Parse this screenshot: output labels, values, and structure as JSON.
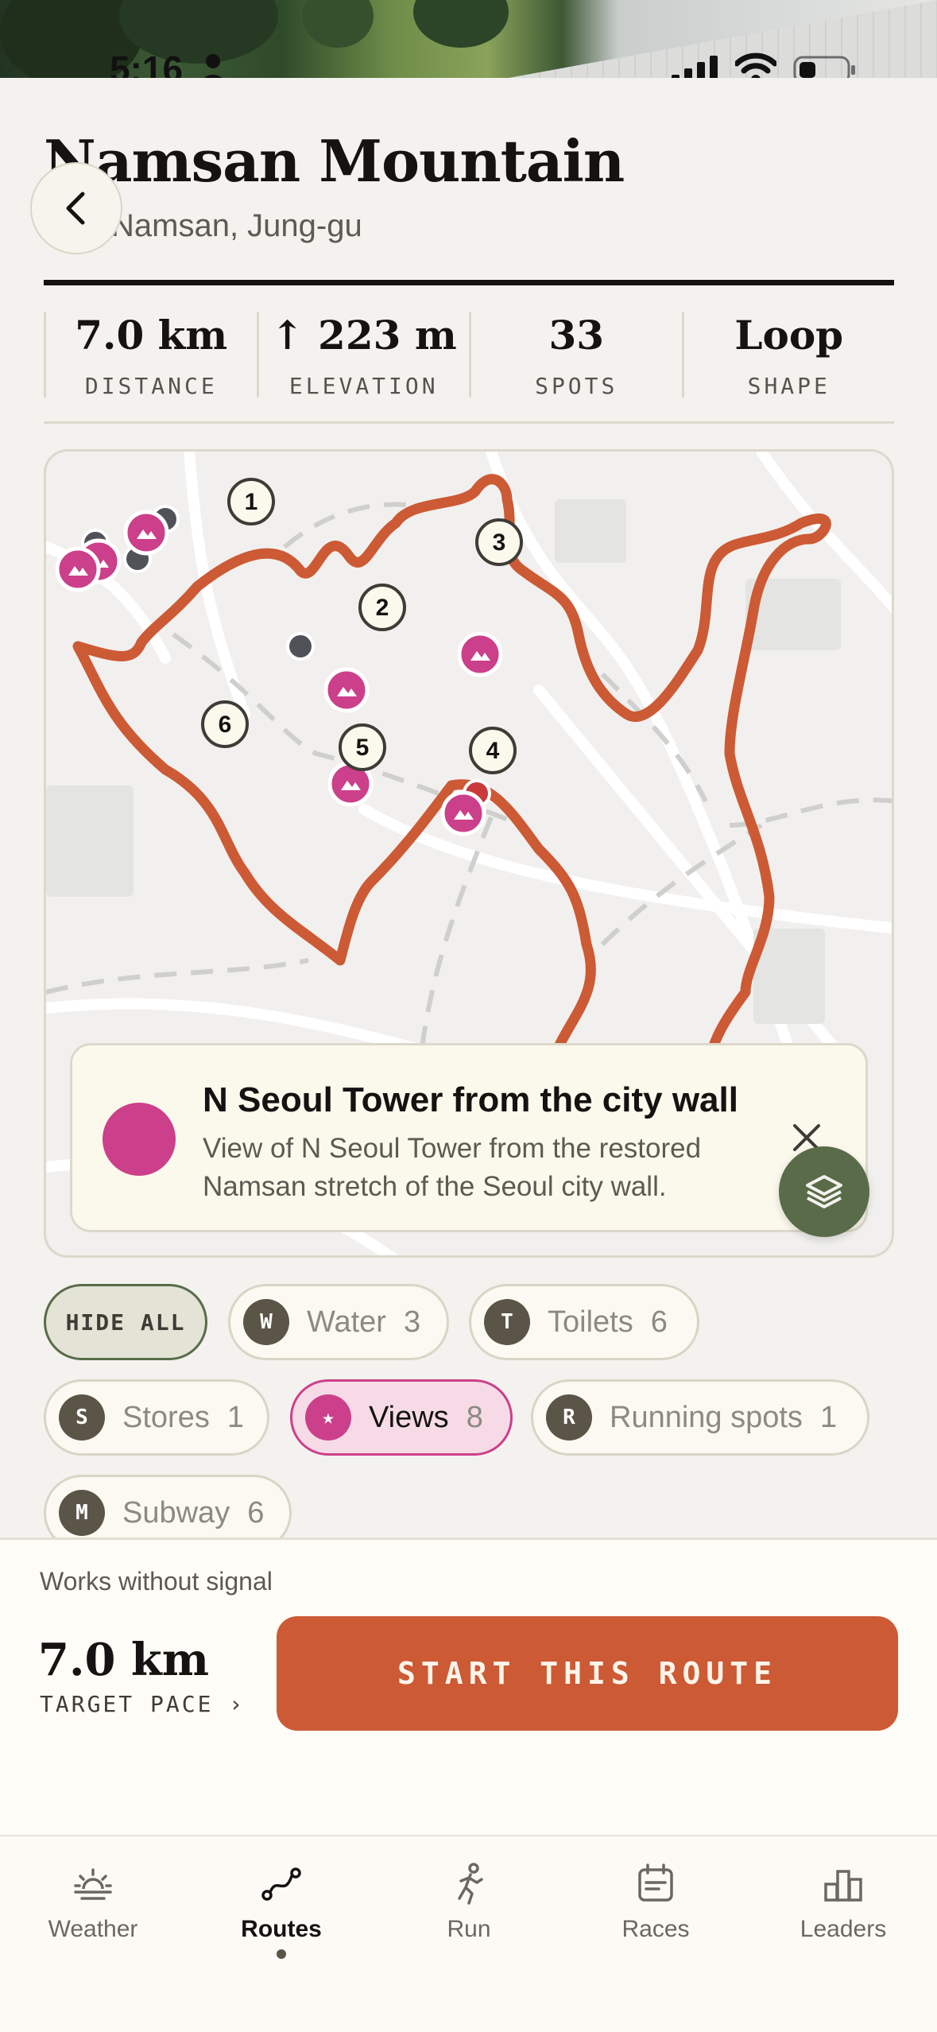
{
  "status_bar": {
    "time": "5:16"
  },
  "header": {
    "title": "Namsan Mountain",
    "subtitle": "Namsan, Jung-gu"
  },
  "stats": [
    {
      "value": "7.0 km",
      "label": "DISTANCE"
    },
    {
      "value": "↑ 223 m",
      "label": "ELEVATION"
    },
    {
      "value": "33",
      "label": "SPOTS"
    },
    {
      "value": "Loop",
      "label": "SHAPE"
    }
  ],
  "map": {
    "markers": [
      "1",
      "2",
      "3",
      "4",
      "5",
      "6"
    ],
    "route_color": "#cc5a35",
    "view_color": "#cc3f8a"
  },
  "callout": {
    "title": "N Seoul Tower from the city wall",
    "description": "View of N Seoul Tower from the restored Namsan stretch of the Seoul city wall."
  },
  "filters": {
    "hide_all": "HIDE ALL",
    "chips": [
      {
        "badge": "W",
        "label": "Water",
        "count": "3"
      },
      {
        "badge": "T",
        "label": "Toilets",
        "count": "6"
      },
      {
        "badge": "S",
        "label": "Stores",
        "count": "1"
      },
      {
        "badge": "★",
        "label": "Views",
        "count": "8"
      },
      {
        "badge": "R",
        "label": "Running spots",
        "count": "1"
      },
      {
        "badge": "M",
        "label": "Subway",
        "count": "6"
      }
    ]
  },
  "route_card": {
    "offline_note": "Works without signal",
    "distance": "7.0 km",
    "pace_link": "TARGET PACE ›",
    "start_label": "START THIS ROUTE"
  },
  "tabbar": {
    "tabs": [
      {
        "label": "Weather",
        "icon": "sun-horizon-icon"
      },
      {
        "label": "Routes",
        "icon": "route-icon"
      },
      {
        "label": "Run",
        "icon": "runner-icon"
      },
      {
        "label": "Races",
        "icon": "calendar-icon"
      },
      {
        "label": "Leaders",
        "icon": "bar-chart-icon"
      }
    ],
    "active": "Routes"
  }
}
